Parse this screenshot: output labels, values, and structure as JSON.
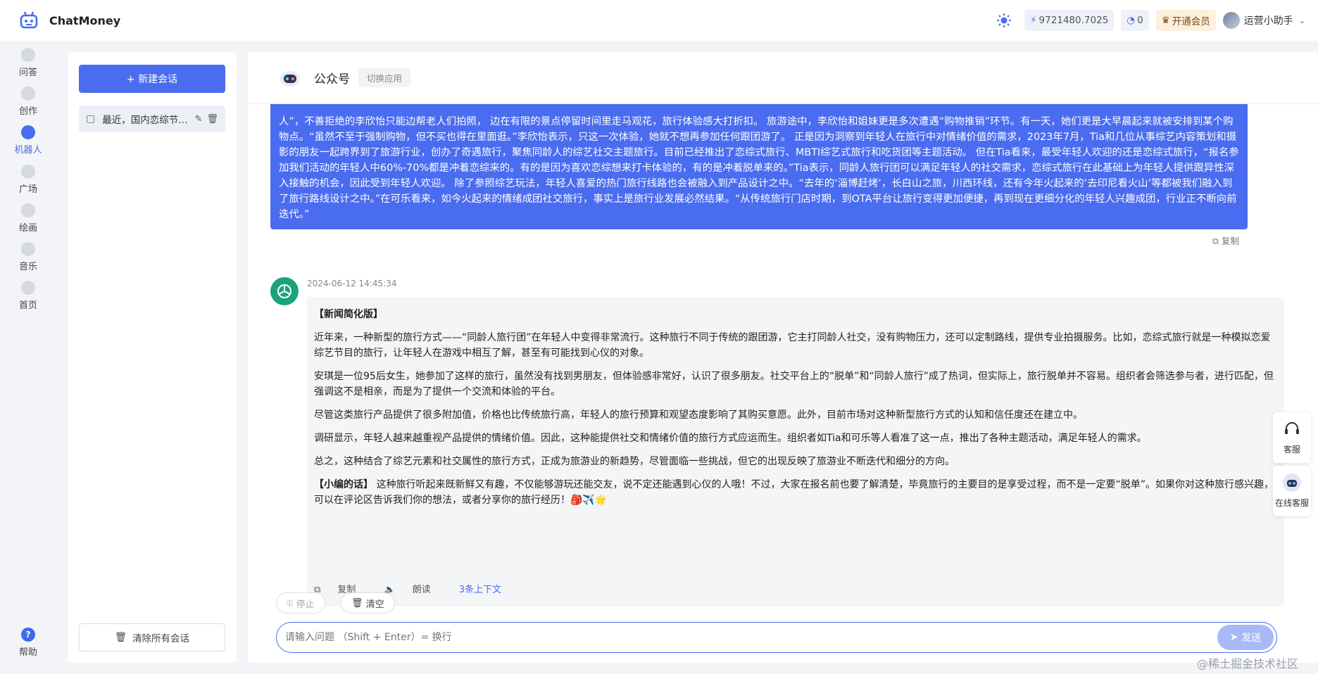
{
  "app": {
    "title": "ChatMoney"
  },
  "topbar": {
    "balance": "9721480.7025",
    "messages": "0",
    "vip_label": "开通会员",
    "user_name": "运营小助手"
  },
  "nav": {
    "items": [
      {
        "label": "问答",
        "icon": "qa-icon"
      },
      {
        "label": "创作",
        "icon": "pen-icon"
      },
      {
        "label": "机器人",
        "icon": "robot-icon"
      },
      {
        "label": "广场",
        "icon": "grid-icon"
      },
      {
        "label": "绘画",
        "icon": "palette-icon"
      },
      {
        "label": "音乐",
        "icon": "music-icon"
      },
      {
        "label": "首页",
        "icon": "home-icon"
      }
    ],
    "help_label": "帮助"
  },
  "sessions": {
    "new_label": "+ 新建会话",
    "items": [
      {
        "title": "最近，国内恋综节目..."
      }
    ],
    "clear_label": "清除所有会话"
  },
  "chat": {
    "app_name": "公众号",
    "switch_label": "切换应用",
    "user_message": "人”，不善拒绝的李欣怡只能边帮老人们拍照， 边在有限的景点停留时间里走马观花，旅行体验感大打折扣。 旅游途中，李欣怡和姐妹更是多次遭遇“购物推销”环节。有一天，她们更是大早晨起来就被安排到某个购物点。“虽然不至于强制购物，但不买也得在里面逛。”李欣怡表示，只这一次体验，她就不想再参加任何跟团游了。 正是因为洞察到年轻人在旅行中对情绪价值的需求，2023年7月，Tia和几位从事综艺内容策划和摄影的朋友一起跨界到了旅游行业，创办了奇遇旅行，聚焦同龄人的综艺社交主题旅行。目前已经推出了恋综式旅行、MBTI综艺式旅行和吃货团等主题活动。 但在Tia看来，最受年轻人欢迎的还是恋综式旅行，“报名参加我们活动的年轻人中60%-70%都是冲着恋综来的。有的是因为喜欢恋综想来打卡体验的，有的是冲着脱单来的。”Tia表示，同龄人旅行团可以满足年轻人的社交需求，恋综式旅行在此基础上为年轻人提供跟异性深入接触的机会，因此受到年轻人欢迎。 除了参照综艺玩法，年轻人喜爱的热门旅行线路也会被融入到产品设计之中。“去年的‘淄博赶烤’，长白山之旅，川西环线，还有今年火起来的‘去印尼看火山’等都被我们融入到了旅行路线设计之中。”在可乐看来，如今火起来的情绪成团社交旅行，事实上是旅行业发展必然结果。“从传统旅行门店时期，到OTA平台让旅行变得更加便捷，再到现在更细分化的年轻人兴趣成团，行业正不断向前迭代。”",
    "copy_label": "复制",
    "bot_time": "2024-06-12 14:45:34",
    "bot_heading": "【新闻简化版】",
    "bot_paragraphs": [
      "近年来，一种新型的旅行方式——“同龄人旅行团”在年轻人中变得非常流行。这种旅行不同于传统的跟团游，它主打同龄人社交，没有购物压力，还可以定制路线，提供专业拍摄服务。比如，恋综式旅行就是一种模拟恋爱综艺节目的旅行，让年轻人在游戏中相互了解，甚至有可能找到心仪的对象。",
      "安琪是一位95后女生，她参加了这样的旅行，虽然没有找到男朋友，但体验感非常好，认识了很多朋友。社交平台上的“脱单”和“同龄人旅行”成了热词，但实际上，旅行脱单并不容易。组织者会筛选参与者，进行匹配，但强调这不是相亲，而是为了提供一个交流和体验的平台。",
      "尽管这类旅行产品提供了很多附加值，价格也比传统旅行高，年轻人的旅行预算和观望态度影响了其购买意愿。此外，目前市场对这种新型旅行方式的认知和信任度还在建立中。",
      "调研显示，年轻人越来越重视产品提供的情绪价值。因此，这种能提供社交和情绪价值的旅行方式应运而生。组织者如Tia和可乐等人看准了这一点，推出了各种主题活动，满足年轻人的需求。",
      "总之，这种结合了综艺元素和社交属性的旅行方式，正成为旅游业的新趋势，尽管面临一些挑战，但它的出现反映了旅游业不断迭代和细分的方向。"
    ],
    "editor_label": "【小编的话】",
    "editor_text": " 这种旅行听起来既新鲜又有趣，不仅能够游玩还能交友，说不定还能遇到心仪的人哦！不过，大家在报名前也要了解清楚，毕竟旅行的主要目的是享受过程，而不是一定要“脱单”。如果你对这种旅行感兴趣，可以在评论区告诉我们你的想法，或者分享你的旅行经历！🎒✈️🌟",
    "actions": {
      "copy": "复制",
      "read": "朗读",
      "context": "3条上下文"
    },
    "stop_label": "停止",
    "clear_label": "清空",
    "input_placeholder": "请输入问题 （Shift + Enter）= 换行",
    "send_label": "发送"
  },
  "float": {
    "service": "客服",
    "online_service": "在线客服"
  },
  "watermark": "@稀土掘金技术社区",
  "colors": {
    "accent": "#4a6cf0",
    "bot_avatar": "#19a37d"
  }
}
